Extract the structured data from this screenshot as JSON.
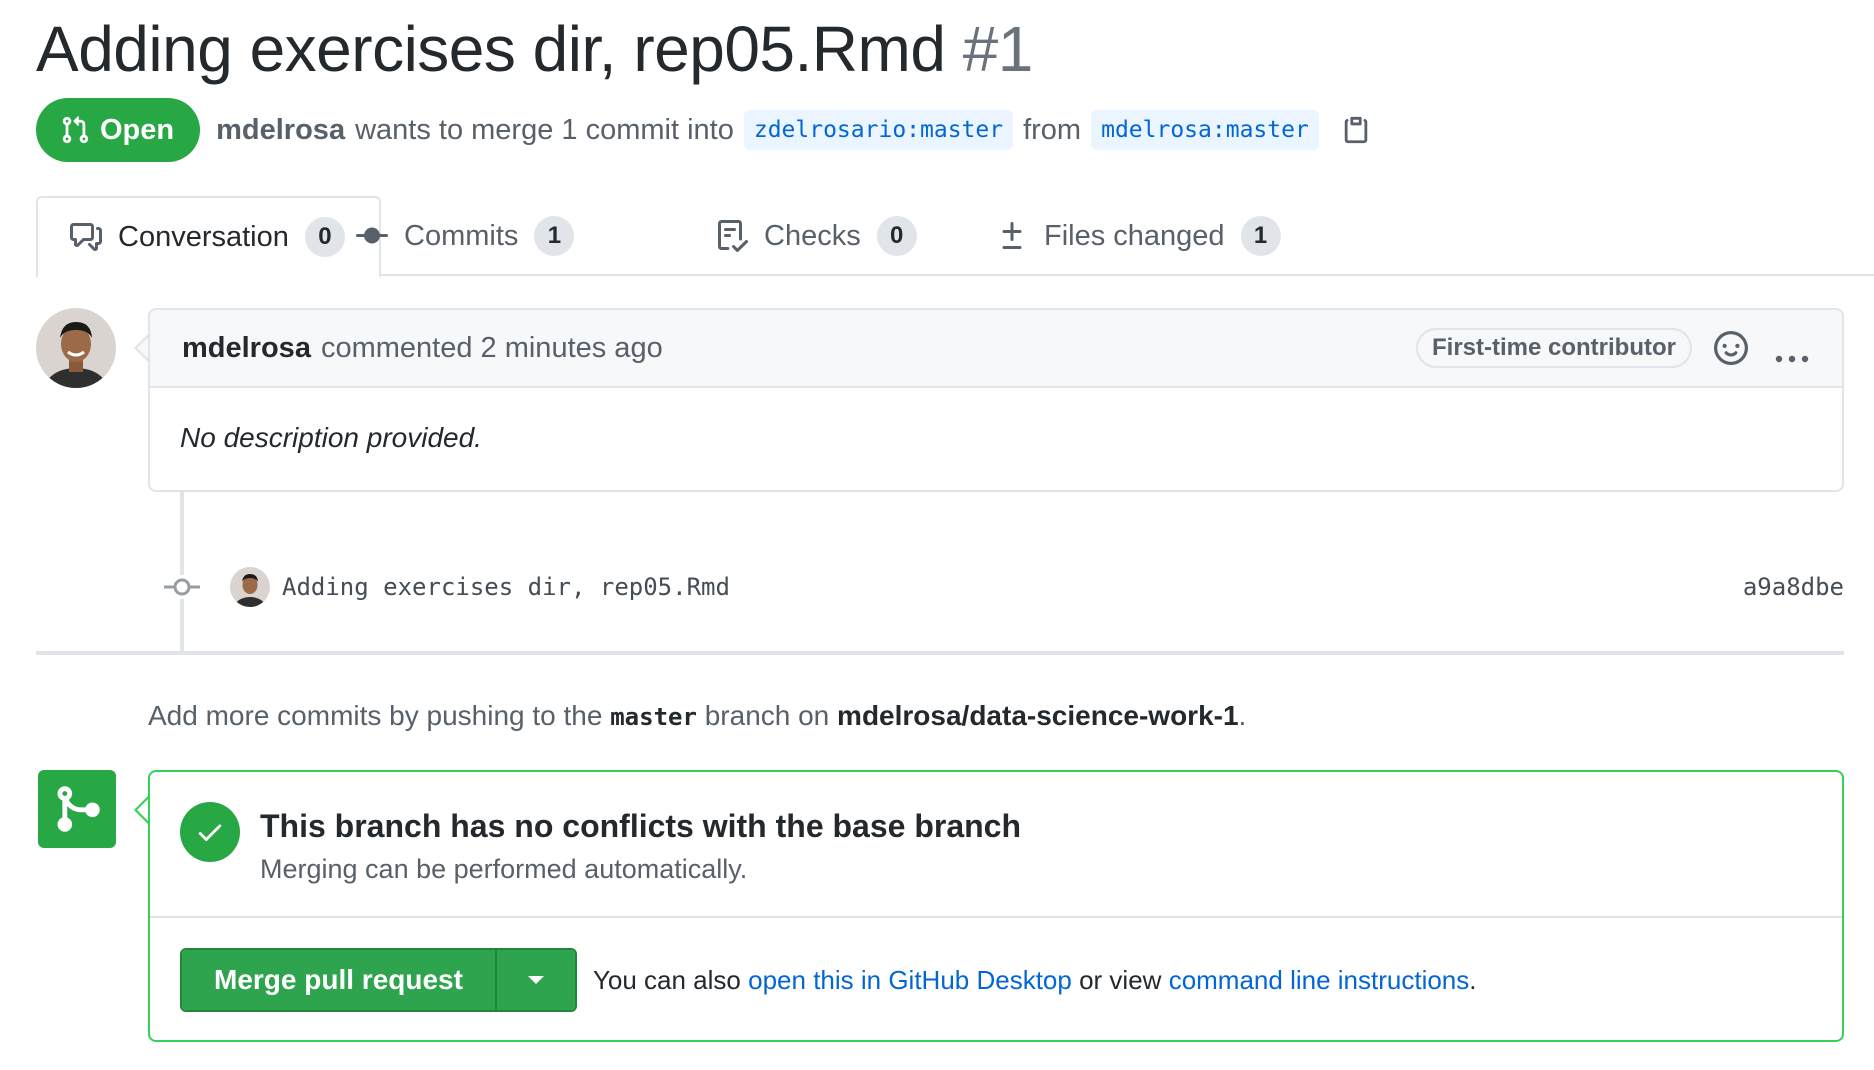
{
  "pr": {
    "title": "Adding exercises dir, rep05.Rmd",
    "number": "#1",
    "state": "Open",
    "author": "mdelrosa",
    "merge_text": "wants to merge 1 commit into",
    "base_branch": "zdelrosario:master",
    "from_text": "from",
    "head_branch": "mdelrosa:master"
  },
  "tabs": [
    {
      "label": "Conversation",
      "count": "0"
    },
    {
      "label": "Commits",
      "count": "1"
    },
    {
      "label": "Checks",
      "count": "0"
    },
    {
      "label": "Files changed",
      "count": "1"
    }
  ],
  "comment": {
    "author": "mdelrosa",
    "action": "commented 2 minutes ago",
    "badge": "First-time contributor",
    "body": "No description provided."
  },
  "commit": {
    "message": "Adding exercises dir, rep05.Rmd",
    "sha": "a9a8dbe"
  },
  "hint": {
    "prefix": "Add more commits by pushing to the",
    "branch": "master",
    "middle": "branch on",
    "repo": "mdelrosa/data-science-work-1",
    "suffix": "."
  },
  "merge": {
    "title": "This branch has no conflicts with the base branch",
    "subtitle": "Merging can be performed automatically.",
    "button": "Merge pull request",
    "alt_prefix": "You can also",
    "desktop_link": "open this in GitHub Desktop",
    "alt_middle": "or view",
    "cli_link": "command line instructions",
    "alt_suffix": "."
  },
  "colors": {
    "success": "#28a745",
    "link": "#0366d6",
    "border": "#e1e4e8",
    "muted": "#586069"
  },
  "icons": [
    "git-pull-request-icon",
    "clipboard-icon",
    "comment-discussion-icon",
    "git-commit-icon",
    "checklist-icon",
    "file-diff-icon",
    "smiley-icon",
    "kebab-horizontal-icon",
    "git-merge-icon",
    "check-icon",
    "triangle-down-icon"
  ]
}
